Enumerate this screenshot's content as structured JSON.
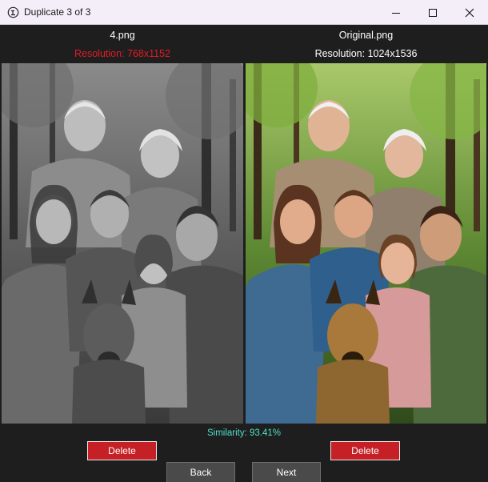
{
  "window": {
    "title": "Duplicate 3 of 3",
    "controls": {
      "minimize_icon": "minimize-icon",
      "maximize_icon": "maximize-icon",
      "close_icon": "close-icon"
    }
  },
  "left": {
    "filename": "4.png",
    "resolution": "Resolution: 768x1152",
    "resolution_color": "#e01c24",
    "image": "grayscale family portrait with dog in park",
    "delete_label": "Delete"
  },
  "right": {
    "filename": "Original.png",
    "resolution": "Resolution: 1024x1536",
    "resolution_color": "#ffffff",
    "image": "color family portrait with dog in park",
    "delete_label": "Delete"
  },
  "similarity": "Similarity: 93.41%",
  "nav": {
    "back_label": "Back",
    "next_label": "Next"
  },
  "colors": {
    "delete": "#c42025",
    "accent_similarity": "#4de0c8",
    "background": "#1e1e1e"
  }
}
